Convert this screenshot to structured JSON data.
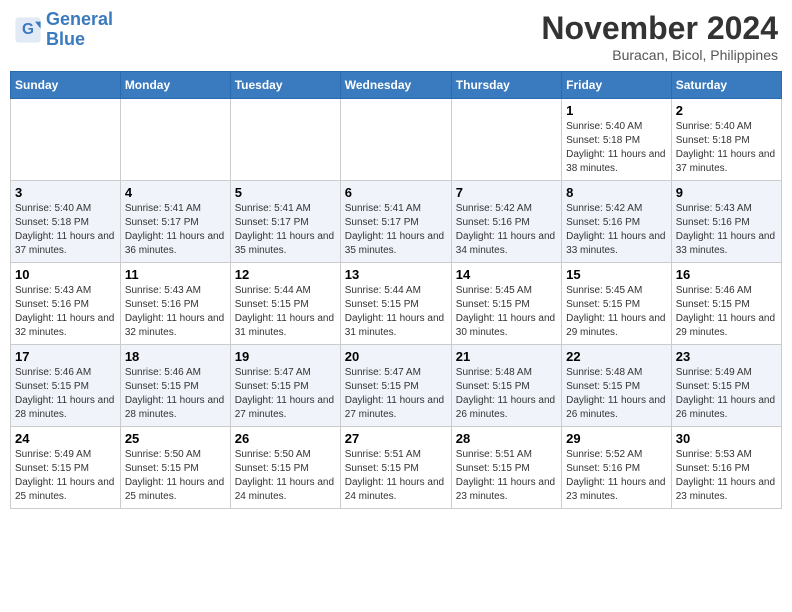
{
  "logo": {
    "line1": "General",
    "line2": "Blue"
  },
  "title": "November 2024",
  "subtitle": "Buracan, Bicol, Philippines",
  "days_of_week": [
    "Sunday",
    "Monday",
    "Tuesday",
    "Wednesday",
    "Thursday",
    "Friday",
    "Saturday"
  ],
  "weeks": [
    [
      {
        "day": "",
        "sunrise": "",
        "sunset": "",
        "daylight": ""
      },
      {
        "day": "",
        "sunrise": "",
        "sunset": "",
        "daylight": ""
      },
      {
        "day": "",
        "sunrise": "",
        "sunset": "",
        "daylight": ""
      },
      {
        "day": "",
        "sunrise": "",
        "sunset": "",
        "daylight": ""
      },
      {
        "day": "",
        "sunrise": "",
        "sunset": "",
        "daylight": ""
      },
      {
        "day": "1",
        "sunrise": "Sunrise: 5:40 AM",
        "sunset": "Sunset: 5:18 PM",
        "daylight": "Daylight: 11 hours and 38 minutes."
      },
      {
        "day": "2",
        "sunrise": "Sunrise: 5:40 AM",
        "sunset": "Sunset: 5:18 PM",
        "daylight": "Daylight: 11 hours and 37 minutes."
      }
    ],
    [
      {
        "day": "3",
        "sunrise": "Sunrise: 5:40 AM",
        "sunset": "Sunset: 5:18 PM",
        "daylight": "Daylight: 11 hours and 37 minutes."
      },
      {
        "day": "4",
        "sunrise": "Sunrise: 5:41 AM",
        "sunset": "Sunset: 5:17 PM",
        "daylight": "Daylight: 11 hours and 36 minutes."
      },
      {
        "day": "5",
        "sunrise": "Sunrise: 5:41 AM",
        "sunset": "Sunset: 5:17 PM",
        "daylight": "Daylight: 11 hours and 35 minutes."
      },
      {
        "day": "6",
        "sunrise": "Sunrise: 5:41 AM",
        "sunset": "Sunset: 5:17 PM",
        "daylight": "Daylight: 11 hours and 35 minutes."
      },
      {
        "day": "7",
        "sunrise": "Sunrise: 5:42 AM",
        "sunset": "Sunset: 5:16 PM",
        "daylight": "Daylight: 11 hours and 34 minutes."
      },
      {
        "day": "8",
        "sunrise": "Sunrise: 5:42 AM",
        "sunset": "Sunset: 5:16 PM",
        "daylight": "Daylight: 11 hours and 33 minutes."
      },
      {
        "day": "9",
        "sunrise": "Sunrise: 5:43 AM",
        "sunset": "Sunset: 5:16 PM",
        "daylight": "Daylight: 11 hours and 33 minutes."
      }
    ],
    [
      {
        "day": "10",
        "sunrise": "Sunrise: 5:43 AM",
        "sunset": "Sunset: 5:16 PM",
        "daylight": "Daylight: 11 hours and 32 minutes."
      },
      {
        "day": "11",
        "sunrise": "Sunrise: 5:43 AM",
        "sunset": "Sunset: 5:16 PM",
        "daylight": "Daylight: 11 hours and 32 minutes."
      },
      {
        "day": "12",
        "sunrise": "Sunrise: 5:44 AM",
        "sunset": "Sunset: 5:15 PM",
        "daylight": "Daylight: 11 hours and 31 minutes."
      },
      {
        "day": "13",
        "sunrise": "Sunrise: 5:44 AM",
        "sunset": "Sunset: 5:15 PM",
        "daylight": "Daylight: 11 hours and 31 minutes."
      },
      {
        "day": "14",
        "sunrise": "Sunrise: 5:45 AM",
        "sunset": "Sunset: 5:15 PM",
        "daylight": "Daylight: 11 hours and 30 minutes."
      },
      {
        "day": "15",
        "sunrise": "Sunrise: 5:45 AM",
        "sunset": "Sunset: 5:15 PM",
        "daylight": "Daylight: 11 hours and 29 minutes."
      },
      {
        "day": "16",
        "sunrise": "Sunrise: 5:46 AM",
        "sunset": "Sunset: 5:15 PM",
        "daylight": "Daylight: 11 hours and 29 minutes."
      }
    ],
    [
      {
        "day": "17",
        "sunrise": "Sunrise: 5:46 AM",
        "sunset": "Sunset: 5:15 PM",
        "daylight": "Daylight: 11 hours and 28 minutes."
      },
      {
        "day": "18",
        "sunrise": "Sunrise: 5:46 AM",
        "sunset": "Sunset: 5:15 PM",
        "daylight": "Daylight: 11 hours and 28 minutes."
      },
      {
        "day": "19",
        "sunrise": "Sunrise: 5:47 AM",
        "sunset": "Sunset: 5:15 PM",
        "daylight": "Daylight: 11 hours and 27 minutes."
      },
      {
        "day": "20",
        "sunrise": "Sunrise: 5:47 AM",
        "sunset": "Sunset: 5:15 PM",
        "daylight": "Daylight: 11 hours and 27 minutes."
      },
      {
        "day": "21",
        "sunrise": "Sunrise: 5:48 AM",
        "sunset": "Sunset: 5:15 PM",
        "daylight": "Daylight: 11 hours and 26 minutes."
      },
      {
        "day": "22",
        "sunrise": "Sunrise: 5:48 AM",
        "sunset": "Sunset: 5:15 PM",
        "daylight": "Daylight: 11 hours and 26 minutes."
      },
      {
        "day": "23",
        "sunrise": "Sunrise: 5:49 AM",
        "sunset": "Sunset: 5:15 PM",
        "daylight": "Daylight: 11 hours and 26 minutes."
      }
    ],
    [
      {
        "day": "24",
        "sunrise": "Sunrise: 5:49 AM",
        "sunset": "Sunset: 5:15 PM",
        "daylight": "Daylight: 11 hours and 25 minutes."
      },
      {
        "day": "25",
        "sunrise": "Sunrise: 5:50 AM",
        "sunset": "Sunset: 5:15 PM",
        "daylight": "Daylight: 11 hours and 25 minutes."
      },
      {
        "day": "26",
        "sunrise": "Sunrise: 5:50 AM",
        "sunset": "Sunset: 5:15 PM",
        "daylight": "Daylight: 11 hours and 24 minutes."
      },
      {
        "day": "27",
        "sunrise": "Sunrise: 5:51 AM",
        "sunset": "Sunset: 5:15 PM",
        "daylight": "Daylight: 11 hours and 24 minutes."
      },
      {
        "day": "28",
        "sunrise": "Sunrise: 5:51 AM",
        "sunset": "Sunset: 5:15 PM",
        "daylight": "Daylight: 11 hours and 23 minutes."
      },
      {
        "day": "29",
        "sunrise": "Sunrise: 5:52 AM",
        "sunset": "Sunset: 5:16 PM",
        "daylight": "Daylight: 11 hours and 23 minutes."
      },
      {
        "day": "30",
        "sunrise": "Sunrise: 5:53 AM",
        "sunset": "Sunset: 5:16 PM",
        "daylight": "Daylight: 11 hours and 23 minutes."
      }
    ]
  ]
}
